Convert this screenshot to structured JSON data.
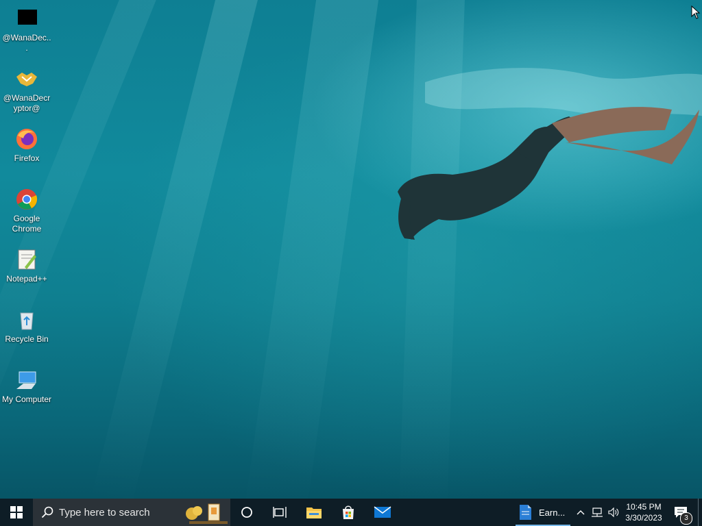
{
  "desktop": {
    "icons": [
      {
        "label": "@WanaDec...",
        "icon": "black-square-icon"
      },
      {
        "label": "@WanaDecryptor@",
        "icon": "handshake-icon"
      },
      {
        "label": "Firefox",
        "icon": "firefox-icon"
      },
      {
        "label": "Google Chrome",
        "icon": "chrome-icon"
      },
      {
        "label": "Notepad++",
        "icon": "notepadpp-icon"
      },
      {
        "label": "Recycle Bin",
        "icon": "recycle-bin-icon"
      },
      {
        "label": "My Computer",
        "icon": "my-computer-icon"
      }
    ]
  },
  "taskbar": {
    "search_placeholder": "Type here to search",
    "running_app_label": "Earn...",
    "time": "10:45 PM",
    "date": "3/30/2023",
    "notification_count": "3"
  },
  "colors": {
    "taskbar_bg": "#0e1d26",
    "search_bg": "#2b3238",
    "accent": "#77b8ea"
  }
}
